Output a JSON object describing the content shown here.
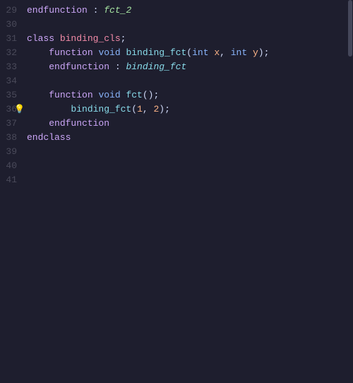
{
  "editor": {
    "background": "#1e1e2e",
    "lines": [
      {
        "number": "29",
        "tokens": [
          {
            "text": "endfunction",
            "class": "kw-keyword"
          },
          {
            "text": " : ",
            "class": ""
          },
          {
            "text": "fct_2",
            "class": "kw-colon-name"
          }
        ]
      },
      {
        "number": "30",
        "tokens": []
      },
      {
        "number": "31",
        "tokens": [
          {
            "text": "class ",
            "class": "kw-keyword"
          },
          {
            "text": "binding_cls",
            "class": "kw-class-name"
          },
          {
            "text": ";",
            "class": ""
          }
        ]
      },
      {
        "number": "32",
        "tokens": [
          {
            "text": "    function ",
            "class": "kw-keyword"
          },
          {
            "text": "void ",
            "class": "kw-type"
          },
          {
            "text": "binding_fct",
            "class": "kw-function-name"
          },
          {
            "text": "(",
            "class": ""
          },
          {
            "text": "int ",
            "class": "kw-type"
          },
          {
            "text": "x",
            "class": "kw-param"
          },
          {
            "text": ", ",
            "class": ""
          },
          {
            "text": "int ",
            "class": "kw-type"
          },
          {
            "text": "y",
            "class": "kw-param"
          },
          {
            "text": ");",
            "class": ""
          }
        ]
      },
      {
        "number": "33",
        "tokens": [
          {
            "text": "    endfunction",
            "class": "kw-keyword"
          },
          {
            "text": " : ",
            "class": ""
          },
          {
            "text": "binding_fct",
            "class": "kw-italic"
          }
        ]
      },
      {
        "number": "34",
        "tokens": []
      },
      {
        "number": "35",
        "tokens": [
          {
            "text": "    function ",
            "class": "kw-keyword"
          },
          {
            "text": "void ",
            "class": "kw-type"
          },
          {
            "text": "fct",
            "class": "kw-function-name"
          },
          {
            "text": "();",
            "class": ""
          }
        ]
      },
      {
        "number": "36",
        "tokens": [
          {
            "text": "        binding_fct",
            "class": "kw-function-name"
          },
          {
            "text": "(",
            "class": ""
          },
          {
            "text": "1",
            "class": "kw-number"
          },
          {
            "text": ", ",
            "class": ""
          },
          {
            "text": "2",
            "class": "kw-number"
          },
          {
            "text": ");",
            "class": ""
          }
        ],
        "lightbulb": true
      },
      {
        "number": "37",
        "tokens": [
          {
            "text": "    endfunction",
            "class": "kw-keyword"
          }
        ]
      },
      {
        "number": "38",
        "tokens": [
          {
            "text": "endclass",
            "class": "kw-keyword"
          }
        ]
      },
      {
        "number": "39",
        "tokens": []
      },
      {
        "number": "40",
        "tokens": []
      },
      {
        "number": "41",
        "tokens": []
      }
    ]
  }
}
